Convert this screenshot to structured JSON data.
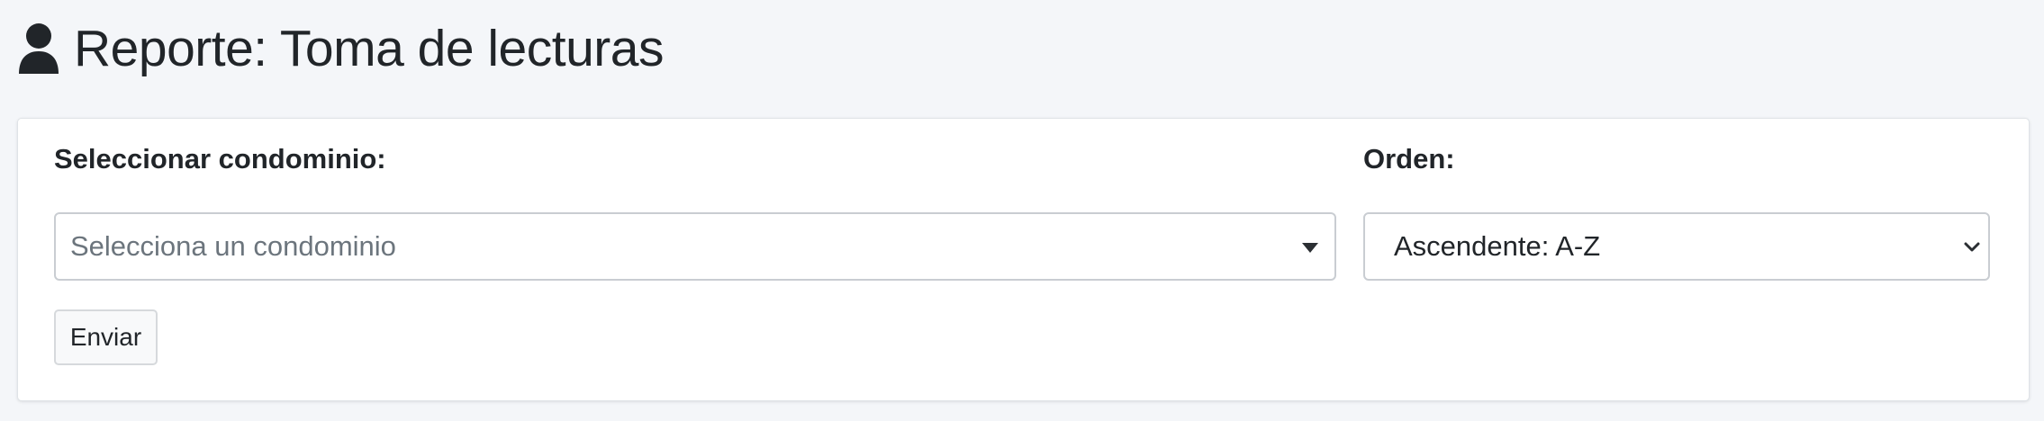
{
  "header": {
    "icon": "user-icon",
    "title": "Reporte: Toma de lecturas"
  },
  "form": {
    "condominio": {
      "label": "Seleccionar condominio:",
      "placeholder": "Selecciona un condominio",
      "icon": "caret-down-icon"
    },
    "orden": {
      "label": "Orden:",
      "selected": "Ascendente: A-Z",
      "icon": "chevron-down-icon"
    },
    "submit_label": "Enviar"
  },
  "colors": {
    "page_background": "#f4f6f9",
    "card_background": "#ffffff",
    "text": "#212529",
    "placeholder": "#6c757d"
  }
}
